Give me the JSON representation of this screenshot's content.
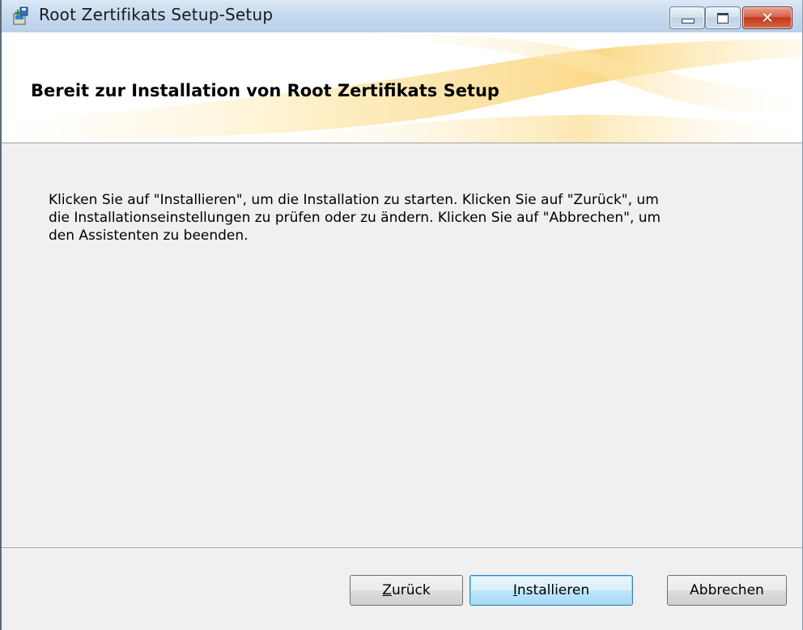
{
  "window": {
    "title": "Root Zertifikats Setup-Setup",
    "icon": "installer-icon",
    "close_glyph": "✕"
  },
  "banner": {
    "title": "Bereit zur Installation von Root Zertifikats Setup"
  },
  "body": {
    "line1": "Klicken Sie auf \"Installieren\", um die Installation zu starten. Klicken Sie auf \"Zurück\", um",
    "line2": "die Installationseinstellungen zu prüfen oder zu ändern. Klicken Sie auf \"Abbrechen\", um",
    "line3": "den Assistenten zu beenden."
  },
  "buttons": {
    "back_mnemonic": "Z",
    "back_rest": "urück",
    "install_mnemonic": "I",
    "install_rest": "nstallieren",
    "cancel": "Abbrechen"
  },
  "colors": {
    "titlebar": "#c5d9ee",
    "close_button": "#c1391c",
    "default_button_border": "#3c7fb1"
  }
}
